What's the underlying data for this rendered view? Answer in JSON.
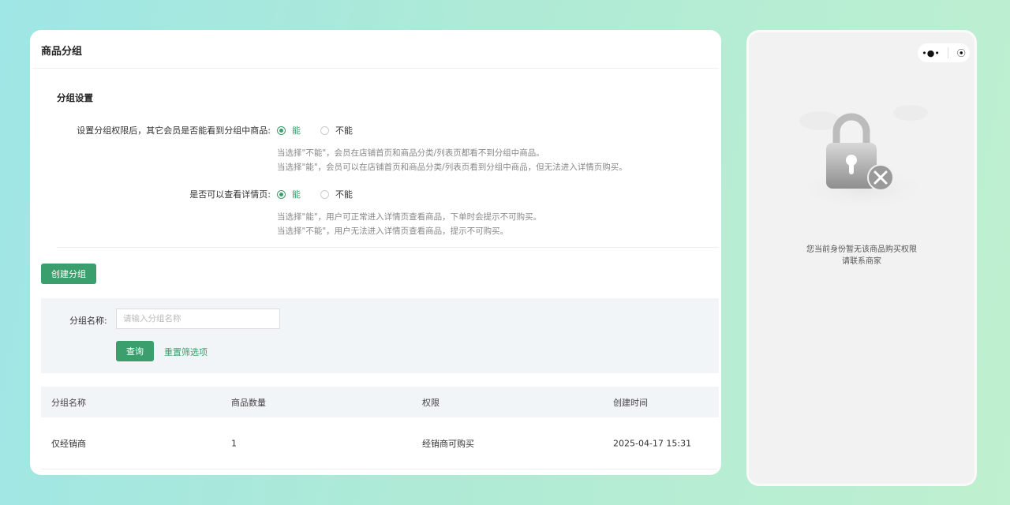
{
  "admin": {
    "title": "商品分组",
    "section_title": "分组设置",
    "setting1": {
      "label": "设置分组权限后，其它会员是否能看到分组中商品:",
      "option_yes": "能",
      "option_no": "不能",
      "selected": "能",
      "hint1": "当选择\"不能\"，会员在店铺首页和商品分类/列表页都看不到分组中商品。",
      "hint2": "当选择\"能\"，会员可以在店铺首页和商品分类/列表页看到分组中商品，但无法进入详情页购买。"
    },
    "setting2": {
      "label": "是否可以查看详情页:",
      "option_yes": "能",
      "option_no": "不能",
      "selected": "能",
      "hint1": "当选择\"能\"，用户可正常进入详情页查看商品，下单时会提示不可购买。",
      "hint2": "当选择\"不能\"，用户无法进入详情页查看商品，提示不可购买。"
    },
    "create_button": "创建分组",
    "filter": {
      "label": "分组名称:",
      "placeholder": "请输入分组名称",
      "value": "",
      "query_button": "查询",
      "reset_link": "重置筛选项"
    },
    "table": {
      "columns": [
        "分组名称",
        "商品数量",
        "权限",
        "创建时间"
      ],
      "rows": [
        [
          "仅经销商",
          "1",
          "经销商可购买",
          "2025-04-17 15:31"
        ]
      ]
    }
  },
  "phone": {
    "capsule_more": "•●•",
    "capsule_close": "⦿",
    "message_line1": "您当前身份暂无该商品购买权限",
    "message_line2": "请联系商家"
  },
  "colors": {
    "accent": "#3a9f6c",
    "filter_bg": "#f2f5f7",
    "page_bg_start": "#9fe6e6",
    "page_bg_end": "#bff0d0"
  },
  "icons": [
    "radio-icon",
    "more-dots-icon",
    "close-circle-icon",
    "lock-icon"
  ]
}
